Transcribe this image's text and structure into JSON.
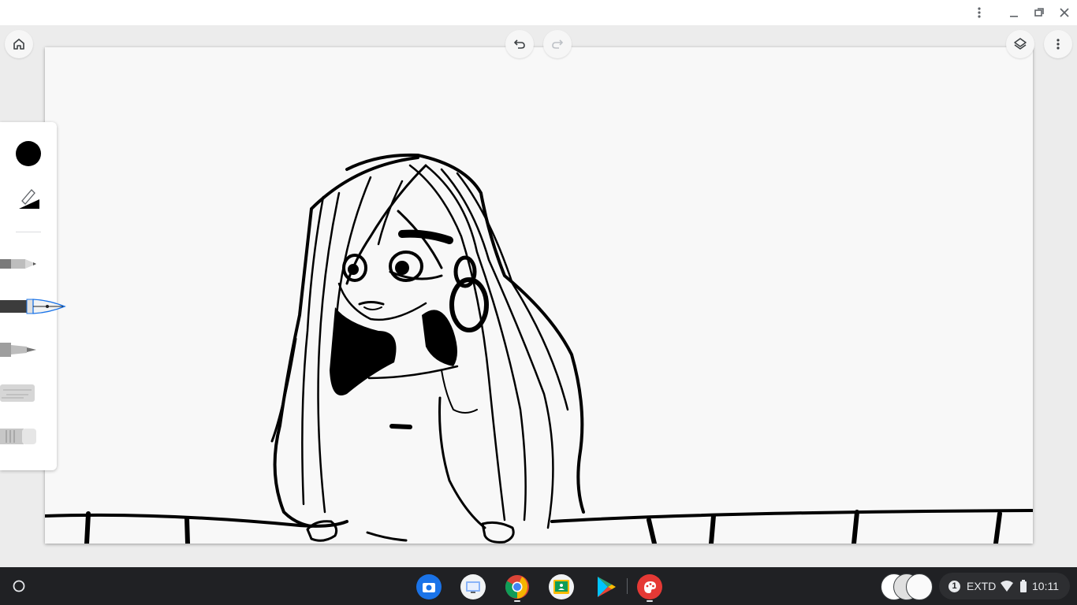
{
  "window": {
    "menu_icon": "vertical-ellipsis-icon",
    "minimize_icon": "minimize-icon",
    "restore_icon": "restore-icon",
    "close_icon": "close-icon"
  },
  "app_bar": {
    "home_icon": "home-icon",
    "undo_icon": "undo-icon",
    "redo_icon": "redo-icon",
    "redo_enabled": false,
    "layers_icon": "layers-icon",
    "more_icon": "vertical-ellipsis-icon"
  },
  "tools": {
    "current_color": "#000000",
    "size_icon": "brush-size-icon",
    "items": [
      {
        "name": "pencil",
        "icon": "pencil-tool-icon",
        "selected": false
      },
      {
        "name": "pen",
        "icon": "fountain-pen-tool-icon",
        "selected": true
      },
      {
        "name": "marker",
        "icon": "marker-tool-icon",
        "selected": false
      },
      {
        "name": "chalk",
        "icon": "chalk-tool-icon",
        "selected": false
      },
      {
        "name": "eraser",
        "icon": "eraser-tool-icon",
        "selected": false
      }
    ]
  },
  "canvas": {
    "background": "#f8f8f8",
    "artwork": "drawing-artwork"
  },
  "shelf": {
    "launcher_icon": "launcher-icon",
    "apps": [
      {
        "name": "camera",
        "icon": "camera-app-icon",
        "running": false
      },
      {
        "name": "screencast",
        "icon": "screencast-app-icon",
        "running": false
      },
      {
        "name": "chrome",
        "icon": "chrome-app-icon",
        "running": true
      },
      {
        "name": "classroom",
        "icon": "classroom-app-icon",
        "running": false
      },
      {
        "name": "play-store",
        "icon": "play-store-app-icon",
        "running": false
      },
      {
        "name": "canvas",
        "icon": "canvas-app-icon",
        "running": true
      }
    ],
    "status": {
      "notification_count": "1",
      "display_mode": "EXTD",
      "time": "10:11"
    }
  },
  "colors": {
    "accent": "#1a73e8",
    "shelf": "#202124",
    "canvas_app_red": "#e53935"
  }
}
